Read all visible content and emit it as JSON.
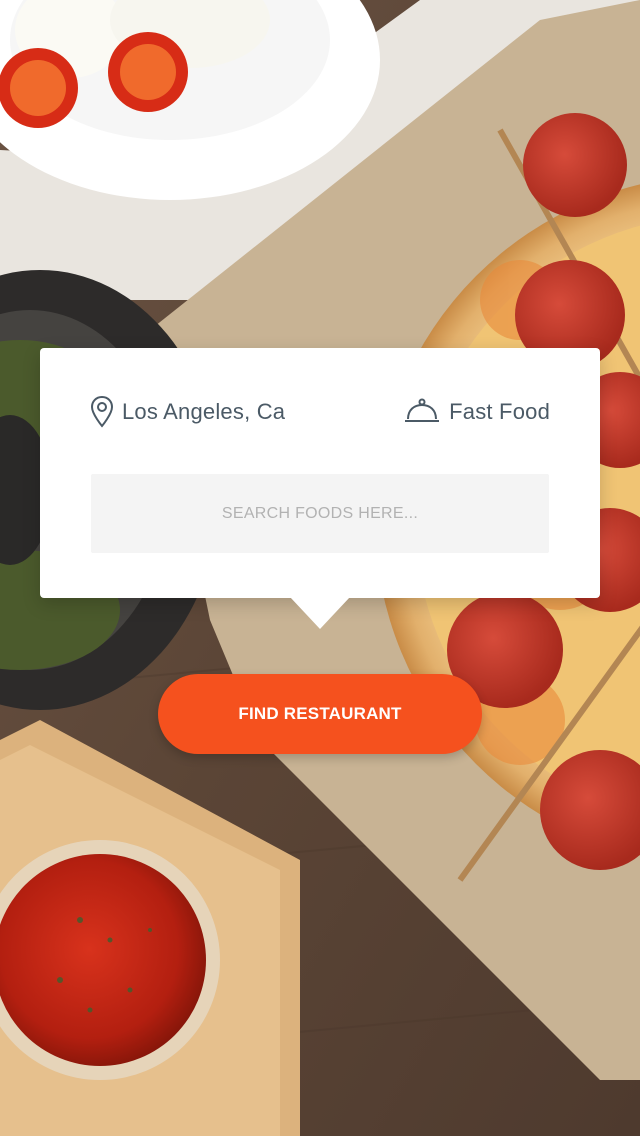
{
  "filters": {
    "location": {
      "icon": "map-pin-icon",
      "label": "Los Angeles, Ca"
    },
    "category": {
      "icon": "food-cloche-icon",
      "label": "Fast Food"
    }
  },
  "search": {
    "placeholder": "SEARCH FOODS HERE..."
  },
  "cta": {
    "label": "FIND RESTAURANT"
  },
  "colors": {
    "accent": "#f5511e",
    "text": "#4b5a66",
    "card": "#ffffff",
    "search_bg": "#f4f4f4"
  }
}
